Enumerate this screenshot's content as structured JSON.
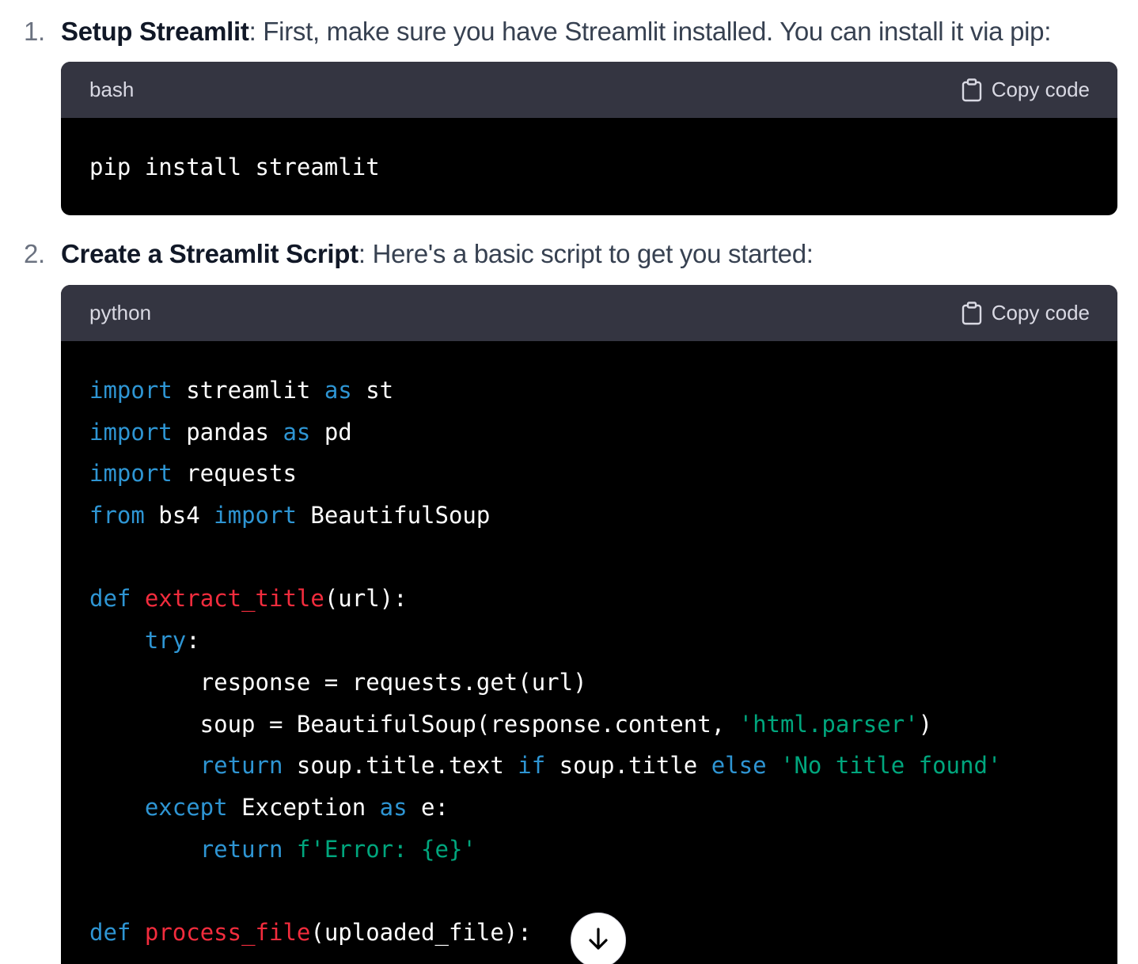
{
  "steps": [
    {
      "number": "1.",
      "title": "Setup Streamlit",
      "text": ": First, make sure you have Streamlit installed. You can install it via pip:"
    },
    {
      "number": "2.",
      "title": "Create a Streamlit Script",
      "text": ": Here's a basic script to get you started:"
    }
  ],
  "code_blocks": [
    {
      "language": "bash",
      "copy_label": "Copy code",
      "lines": [
        [
          {
            "t": "pip install streamlit",
            "c": ""
          }
        ]
      ]
    },
    {
      "language": "python",
      "copy_label": "Copy code",
      "lines": [
        [
          {
            "t": "import",
            "c": "kw"
          },
          {
            "t": " streamlit ",
            "c": ""
          },
          {
            "t": "as",
            "c": "kw"
          },
          {
            "t": " st",
            "c": ""
          }
        ],
        [
          {
            "t": "import",
            "c": "kw"
          },
          {
            "t": " pandas ",
            "c": ""
          },
          {
            "t": "as",
            "c": "kw"
          },
          {
            "t": " pd",
            "c": ""
          }
        ],
        [
          {
            "t": "import",
            "c": "kw"
          },
          {
            "t": " requests",
            "c": ""
          }
        ],
        [
          {
            "t": "from",
            "c": "kw"
          },
          {
            "t": " bs4 ",
            "c": ""
          },
          {
            "t": "import",
            "c": "kw"
          },
          {
            "t": " BeautifulSoup",
            "c": ""
          }
        ],
        [],
        [
          {
            "t": "def",
            "c": "kw"
          },
          {
            "t": " ",
            "c": ""
          },
          {
            "t": "extract_title",
            "c": "fn"
          },
          {
            "t": "(url):",
            "c": ""
          }
        ],
        [
          {
            "t": "    ",
            "c": ""
          },
          {
            "t": "try",
            "c": "kw"
          },
          {
            "t": ":",
            "c": ""
          }
        ],
        [
          {
            "t": "        response = requests.get(url)",
            "c": ""
          }
        ],
        [
          {
            "t": "        soup = BeautifulSoup(response.content, ",
            "c": ""
          },
          {
            "t": "'html.parser'",
            "c": "str"
          },
          {
            "t": ")",
            "c": ""
          }
        ],
        [
          {
            "t": "        ",
            "c": ""
          },
          {
            "t": "return",
            "c": "kw"
          },
          {
            "t": " soup.title.text ",
            "c": ""
          },
          {
            "t": "if",
            "c": "kw"
          },
          {
            "t": " soup.title ",
            "c": ""
          },
          {
            "t": "else",
            "c": "kw"
          },
          {
            "t": " ",
            "c": ""
          },
          {
            "t": "'No title found'",
            "c": "str"
          }
        ],
        [
          {
            "t": "    ",
            "c": ""
          },
          {
            "t": "except",
            "c": "kw"
          },
          {
            "t": " Exception ",
            "c": ""
          },
          {
            "t": "as",
            "c": "kw"
          },
          {
            "t": " e:",
            "c": ""
          }
        ],
        [
          {
            "t": "        ",
            "c": ""
          },
          {
            "t": "return",
            "c": "kw"
          },
          {
            "t": " ",
            "c": ""
          },
          {
            "t": "f'Error: {e}'",
            "c": "str"
          }
        ],
        [],
        [
          {
            "t": "def",
            "c": "kw"
          },
          {
            "t": " ",
            "c": ""
          },
          {
            "t": "process_file",
            "c": "fn"
          },
          {
            "t": "(uploaded_file):",
            "c": ""
          }
        ]
      ]
    }
  ],
  "icons": {
    "copy": "clipboard-icon",
    "scroll": "arrow-down-icon"
  },
  "colors": {
    "keyword": "#2e95d3",
    "function": "#f22c3d",
    "string": "#00a67d",
    "code_header_bg": "#343541",
    "code_bg": "#000000"
  }
}
